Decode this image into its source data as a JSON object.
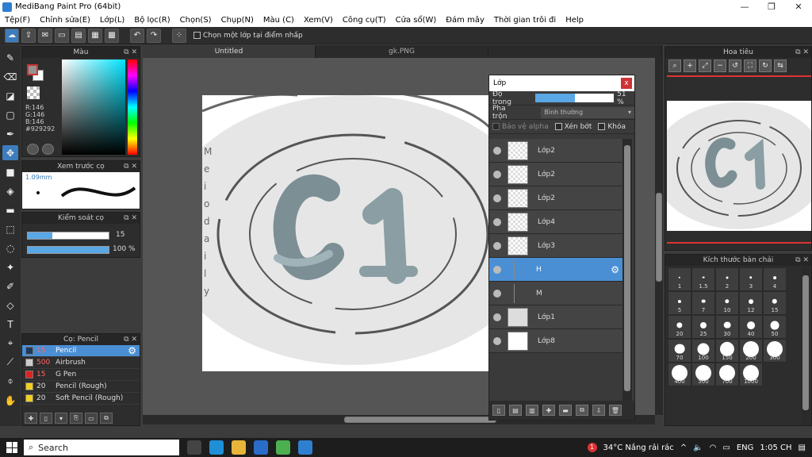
{
  "window": {
    "title": "MediBang Paint Pro (64bit)"
  },
  "menu": [
    "Tệp(F)",
    "Chỉnh sửa(E)",
    "Lớp(L)",
    "Bộ lọc(R)",
    "Chọn(S)",
    "Chụp(N)",
    "Màu (C)",
    "Xem(V)",
    "Công cụ(T)",
    "Cửa sổ(W)",
    "Đám mây",
    "Thời gian trôi đi",
    "Help"
  ],
  "toolbar": {
    "select_layer_label": "Chọn một lớp tại điểm nhấp"
  },
  "color_panel": {
    "title": "Màu",
    "r": "R:146",
    "g": "G:146",
    "b": "B:146",
    "hex": "#929292",
    "fg_color": "#929292"
  },
  "preview_panel": {
    "title": "Xem trước cọ",
    "size": "1.09mm"
  },
  "control_panel": {
    "title": "Kiểm soát cọ",
    "size_value": "15",
    "opacity_value": "100 %",
    "size_fraction": 0.3,
    "opacity_fraction": 1.0
  },
  "brush_panel": {
    "title": "Cọ: Pencil",
    "items": [
      {
        "size": "15",
        "name": "Pencil",
        "color": "#1e3a5a"
      },
      {
        "size": "500",
        "name": "Airbrush",
        "color": "#cccccc"
      },
      {
        "size": "15",
        "name": "G Pen",
        "color": "#dd2222"
      },
      {
        "size": "20",
        "name": "Pencil (Rough)",
        "color": "#f0d020"
      },
      {
        "size": "20",
        "name": "Soft Pencil (Rough)",
        "color": "#f0d020"
      }
    ]
  },
  "tabs": [
    "Untitled",
    "gk.PNG"
  ],
  "canvas": {
    "vertical_text": [
      "M",
      "e",
      "i",
      "o",
      "d",
      "a",
      "i",
      "l",
      "y"
    ],
    "logo_text": "C1"
  },
  "layer_window": {
    "title": "Lớp",
    "close": "x",
    "opacity_label": "Độ trong",
    "opacity_value": "51 %",
    "opacity_fraction": 0.51,
    "blend_label": "Pha trộn",
    "blend_value": "Bình thường",
    "protect_alpha": "Bảo vệ alpha",
    "clipping": "Xén bớt",
    "lock": "Khóa",
    "layers": [
      {
        "name": "Lớp2",
        "thumb": "c1"
      },
      {
        "name": "Lớp2",
        "thumb": "transparent"
      },
      {
        "name": "Lớp2",
        "thumb": "c1-dark"
      },
      {
        "name": "Lớp4",
        "thumb": "transparent"
      },
      {
        "name": "Lớp3",
        "thumb": "transparent"
      },
      {
        "name": "H",
        "thumb": "folder",
        "active": true
      },
      {
        "name": "M",
        "thumb": "folder"
      },
      {
        "name": "Lớp1",
        "thumb": "solid"
      },
      {
        "name": "Lớp8",
        "thumb": "white"
      }
    ]
  },
  "navigator": {
    "title": "Hoa tiêu"
  },
  "brush_size_panel": {
    "title": "Kích thước bàn chải",
    "sizes": [
      "1",
      "1.5",
      "2",
      "3",
      "4",
      "5",
      "7",
      "10",
      "12",
      "15",
      "20",
      "25",
      "30",
      "40",
      "50",
      "70",
      "100",
      "150",
      "200",
      "300",
      "400",
      "500",
      "700",
      "1000"
    ]
  },
  "taskbar": {
    "search": "Search",
    "weather": "34°C  Nắng rải rác",
    "lang": "ENG",
    "time": "1:05 CH",
    "notify_count": "1"
  }
}
